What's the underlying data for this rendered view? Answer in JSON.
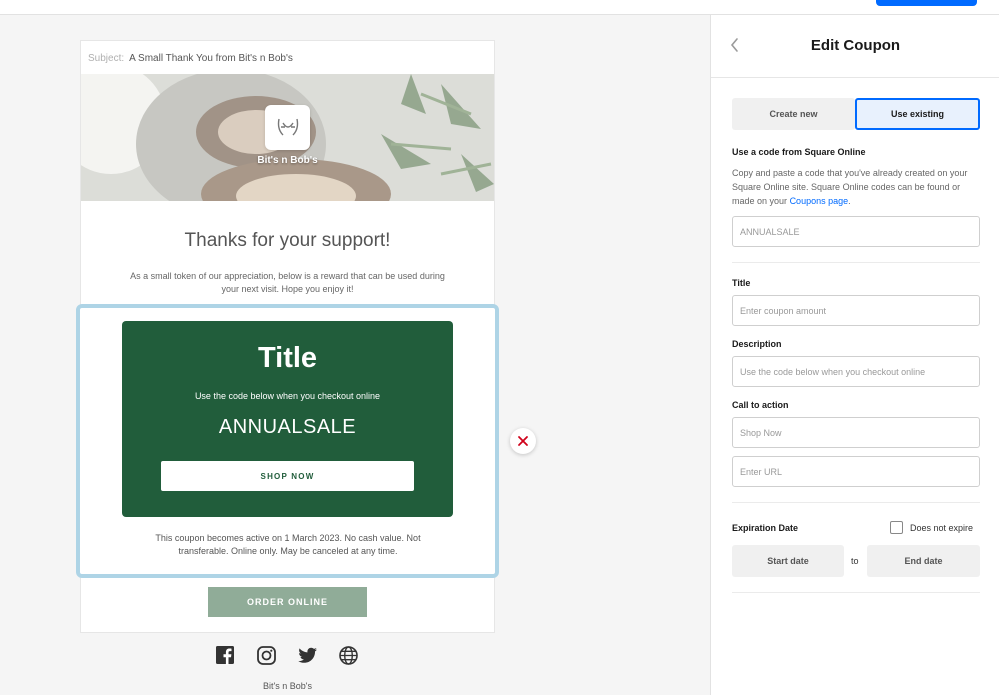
{
  "email": {
    "subject_label": "Subject:",
    "subject_value": "A Small Thank You from Bit's n Bob's",
    "brand_name": "Bit's n Bob's",
    "heading": "Thanks for your support!",
    "intro": "As a small token of our appreciation, below is a reward that can be used during your next visit. Hope you enjoy it!",
    "coupon": {
      "title": "Title",
      "description": "Use the code below when you checkout online",
      "code": "ANNUALSALE",
      "button_label": "SHOP NOW",
      "terms": "This coupon becomes active on 1 March 2023. No cash value. Not transferable. Online only. May be canceled at any time."
    },
    "order_button": "ORDER ONLINE",
    "footer_name": "Bit's n Bob's",
    "social_icons": [
      "facebook-icon",
      "instagram-icon",
      "twitter-icon",
      "website-icon"
    ]
  },
  "panel": {
    "title": "Edit Coupon",
    "tabs": [
      {
        "label": "Create new",
        "active": false
      },
      {
        "label": "Use existing",
        "active": true
      }
    ],
    "section_heading": "Use a code from Square Online",
    "section_text": "Copy and paste a code that you've already created on your Square Online site. Square Online codes can be found or made on your",
    "section_link": "Coupons page",
    "section_text_end": ".",
    "code_placeholder": "ANNUALSALE",
    "title_label": "Title",
    "title_placeholder": "Enter coupon amount",
    "description_label": "Description",
    "description_placeholder": "Use the code below when you checkout online",
    "cta_label": "Call to action",
    "cta_text_placeholder": "Shop Now",
    "cta_url_placeholder": "Enter URL",
    "expiration_label": "Expiration Date",
    "does_not_expire_label": "Does not expire",
    "does_not_expire_checked": false,
    "start_date_label": "Start date",
    "to_label": "to",
    "end_date_label": "End date"
  },
  "colors": {
    "accent": "#006aff",
    "coupon_green": "#215d3b",
    "selection_outline": "#aed4e6",
    "remove_red": "#d0021b"
  }
}
